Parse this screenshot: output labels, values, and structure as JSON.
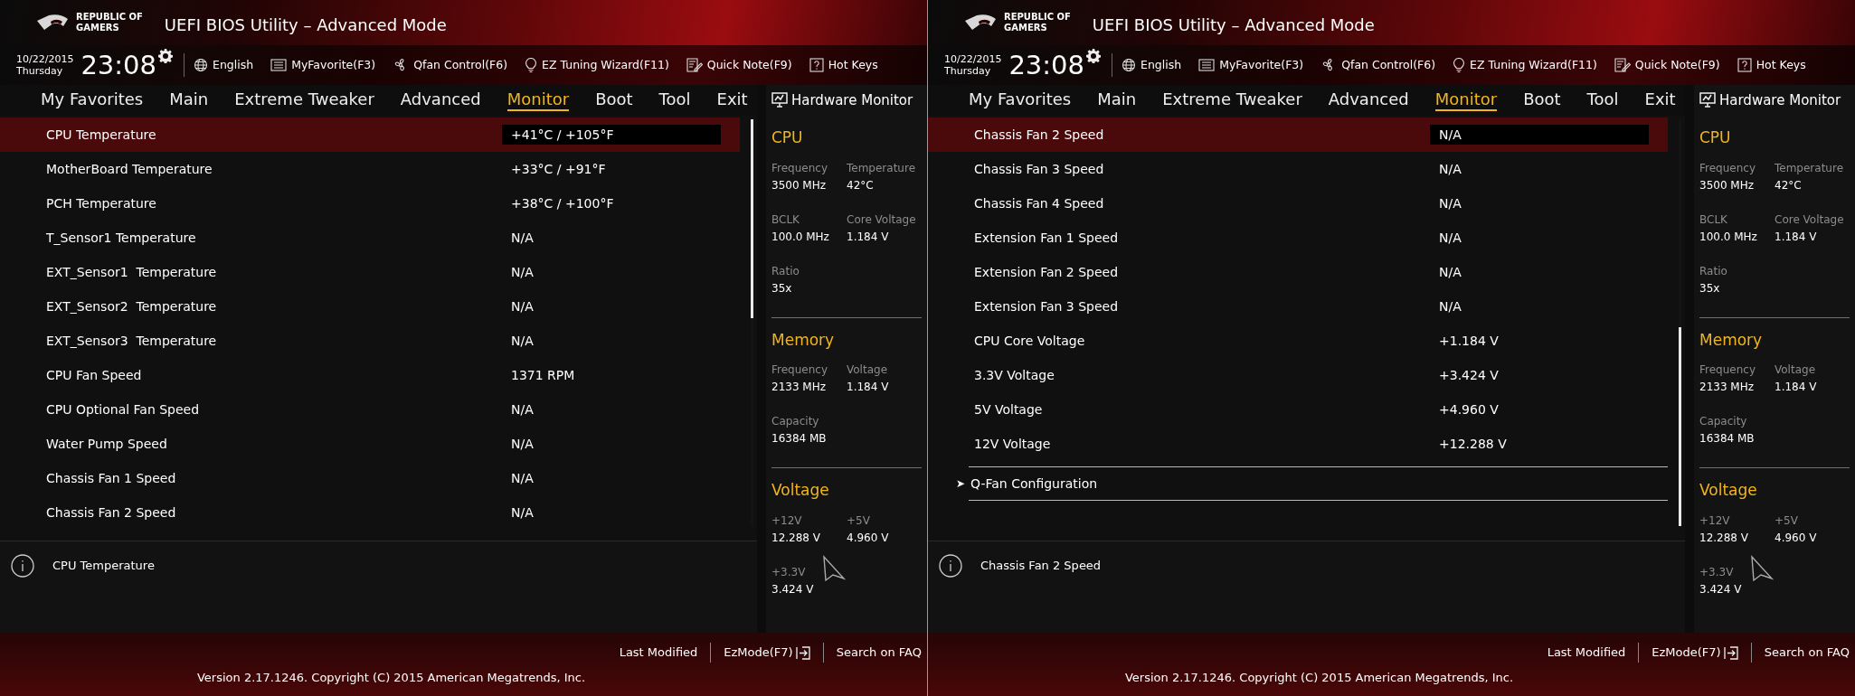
{
  "panels": [
    {
      "header": {
        "logo_text_1": "REPUBLIC OF",
        "logo_text_2": "GAMERS",
        "title": "UEFI BIOS Utility – Advanced Mode"
      },
      "toolbar": {
        "date": "10/22/2015",
        "weekday": "Thursday",
        "time": "23:08",
        "items": [
          {
            "kind": "globe",
            "label": "English"
          },
          {
            "kind": "favorite",
            "label": "MyFavorite(F3)"
          },
          {
            "kind": "fan",
            "label": "Qfan Control(F6)"
          },
          {
            "kind": "bulb",
            "label": "EZ Tuning Wizard(F11)"
          },
          {
            "kind": "note",
            "label": "Quick Note(F9)"
          },
          {
            "kind": "help",
            "label": "Hot Keys"
          }
        ]
      },
      "tabs": [
        {
          "label": "My Favorites",
          "selected": false
        },
        {
          "label": "Main",
          "selected": false
        },
        {
          "label": "Extreme Tweaker",
          "selected": false
        },
        {
          "label": "Advanced",
          "selected": false
        },
        {
          "label": "Monitor",
          "selected": true
        },
        {
          "label": "Boot",
          "selected": false
        },
        {
          "label": "Tool",
          "selected": false
        },
        {
          "label": "Exit",
          "selected": false
        }
      ],
      "scrolled_to_end": false,
      "rows": [
        {
          "kind": "item",
          "label": "CPU Temperature",
          "value": "+41°C / +105°F",
          "selected": true
        },
        {
          "kind": "item",
          "label": "MotherBoard Temperature",
          "value": "+33°C / +91°F",
          "selected": false
        },
        {
          "kind": "item",
          "label": "PCH Temperature",
          "value": "+38°C / +100°F",
          "selected": false
        },
        {
          "kind": "item",
          "label": "T_Sensor1 Temperature",
          "value": "N/A",
          "selected": false
        },
        {
          "kind": "item",
          "label": "EXT_Sensor1  Temperature",
          "value": "N/A",
          "selected": false
        },
        {
          "kind": "item",
          "label": "EXT_Sensor2  Temperature",
          "value": "N/A",
          "selected": false
        },
        {
          "kind": "item",
          "label": "EXT_Sensor3  Temperature",
          "value": "N/A",
          "selected": false
        },
        {
          "kind": "item",
          "label": "CPU Fan Speed",
          "value": "1371 RPM",
          "selected": false
        },
        {
          "kind": "item",
          "label": "CPU Optional Fan Speed",
          "value": "N/A",
          "selected": false
        },
        {
          "kind": "item",
          "label": "Water Pump Speed",
          "value": "N/A",
          "selected": false
        },
        {
          "kind": "item",
          "label": "Chassis Fan 1 Speed",
          "value": "N/A",
          "selected": false
        },
        {
          "kind": "item",
          "label": "Chassis Fan 2 Speed",
          "value": "N/A",
          "selected": false
        }
      ],
      "description": "CPU Temperature",
      "hardware_monitor": {
        "title": "Hardware Monitor",
        "sections": [
          {
            "title": "CPU",
            "fields": [
              {
                "label": "Frequency",
                "value": "3500 MHz"
              },
              {
                "label": "Temperature",
                "value": "42°C"
              },
              {
                "label": "BCLK",
                "value": "100.0 MHz"
              },
              {
                "label": "Core Voltage",
                "value": "1.184 V"
              },
              {
                "label": "Ratio",
                "value": "35x"
              }
            ]
          },
          {
            "title": "Memory",
            "fields": [
              {
                "label": "Frequency",
                "value": "2133 MHz"
              },
              {
                "label": "Voltage",
                "value": "1.184 V"
              },
              {
                "label": "Capacity",
                "value": "16384 MB"
              }
            ]
          },
          {
            "title": "Voltage",
            "fields": [
              {
                "label": "+12V",
                "value": "12.288 V"
              },
              {
                "label": "+5V",
                "value": "4.960 V"
              },
              {
                "label": "+3.3V",
                "value": "3.424 V"
              }
            ]
          }
        ]
      },
      "footer": {
        "links": [
          "Last Modified",
          "EzMode(F7)",
          "Search on FAQ"
        ],
        "version": "Version 2.17.1246. Copyright (C) 2015 American Megatrends, Inc."
      }
    },
    {
      "header": {
        "logo_text_1": "REPUBLIC OF",
        "logo_text_2": "GAMERS",
        "title": "UEFI BIOS Utility – Advanced Mode"
      },
      "toolbar": {
        "date": "10/22/2015",
        "weekday": "Thursday",
        "time": "23:08",
        "items": [
          {
            "kind": "globe",
            "label": "English"
          },
          {
            "kind": "favorite",
            "label": "MyFavorite(F3)"
          },
          {
            "kind": "fan",
            "label": "Qfan Control(F6)"
          },
          {
            "kind": "bulb",
            "label": "EZ Tuning Wizard(F11)"
          },
          {
            "kind": "note",
            "label": "Quick Note(F9)"
          },
          {
            "kind": "help",
            "label": "Hot Keys"
          }
        ]
      },
      "tabs": [
        {
          "label": "My Favorites",
          "selected": false
        },
        {
          "label": "Main",
          "selected": false
        },
        {
          "label": "Extreme Tweaker",
          "selected": false
        },
        {
          "label": "Advanced",
          "selected": false
        },
        {
          "label": "Monitor",
          "selected": true
        },
        {
          "label": "Boot",
          "selected": false
        },
        {
          "label": "Tool",
          "selected": false
        },
        {
          "label": "Exit",
          "selected": false
        }
      ],
      "scrolled_to_end": true,
      "rows": [
        {
          "kind": "item",
          "label": "Chassis Fan 2 Speed",
          "value": "N/A",
          "selected": true
        },
        {
          "kind": "item",
          "label": "Chassis Fan 3 Speed",
          "value": "N/A",
          "selected": false
        },
        {
          "kind": "item",
          "label": "Chassis Fan 4 Speed",
          "value": "N/A",
          "selected": false
        },
        {
          "kind": "item",
          "label": "Extension Fan 1 Speed",
          "value": "N/A",
          "selected": false
        },
        {
          "kind": "item",
          "label": "Extension Fan 2 Speed",
          "value": "N/A",
          "selected": false
        },
        {
          "kind": "item",
          "label": "Extension Fan 3 Speed",
          "value": "N/A",
          "selected": false
        },
        {
          "kind": "item",
          "label": "CPU Core Voltage",
          "value": "+1.184 V",
          "selected": false
        },
        {
          "kind": "item",
          "label": "3.3V Voltage",
          "value": "+3.424 V",
          "selected": false
        },
        {
          "kind": "item",
          "label": "5V Voltage",
          "value": "+4.960 V",
          "selected": false
        },
        {
          "kind": "item",
          "label": "12V Voltage",
          "value": "+12.288 V",
          "selected": false
        },
        {
          "kind": "submenu",
          "marker": "➤",
          "label": "Q-Fan Configuration",
          "selected": false
        }
      ],
      "description": "Chassis Fan 2 Speed",
      "hardware_monitor": {
        "title": "Hardware Monitor",
        "sections": [
          {
            "title": "CPU",
            "fields": [
              {
                "label": "Frequency",
                "value": "3500 MHz"
              },
              {
                "label": "Temperature",
                "value": "42°C"
              },
              {
                "label": "BCLK",
                "value": "100.0 MHz"
              },
              {
                "label": "Core Voltage",
                "value": "1.184 V"
              },
              {
                "label": "Ratio",
                "value": "35x"
              }
            ]
          },
          {
            "title": "Memory",
            "fields": [
              {
                "label": "Frequency",
                "value": "2133 MHz"
              },
              {
                "label": "Voltage",
                "value": "1.184 V"
              },
              {
                "label": "Capacity",
                "value": "16384 MB"
              }
            ]
          },
          {
            "title": "Voltage",
            "fields": [
              {
                "label": "+12V",
                "value": "12.288 V"
              },
              {
                "label": "+5V",
                "value": "4.960 V"
              },
              {
                "label": "+3.3V",
                "value": "3.424 V"
              }
            ]
          }
        ]
      },
      "footer": {
        "links": [
          "Last Modified",
          "EzMode(F7)",
          "Search on FAQ"
        ],
        "version": "Version 2.17.1246. Copyright (C) 2015 American Megatrends, Inc."
      }
    }
  ]
}
